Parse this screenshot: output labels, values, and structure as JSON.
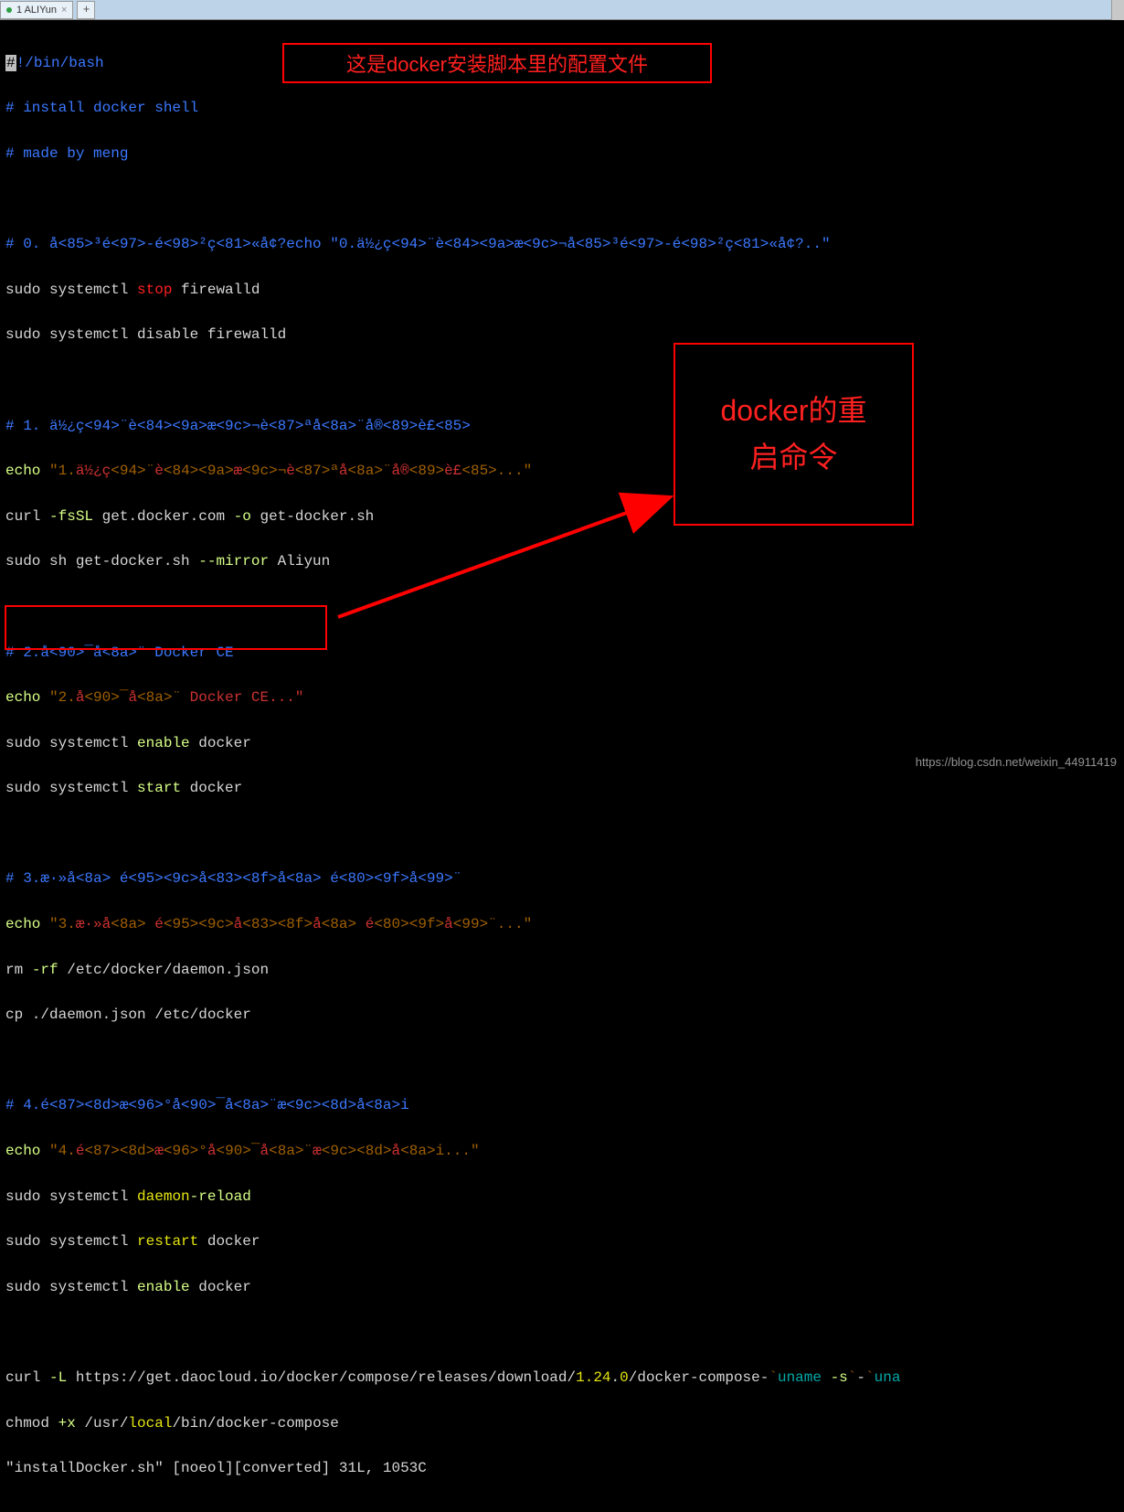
{
  "tab": {
    "title": "1 ALIYun",
    "close": "×",
    "add": "+"
  },
  "callouts": {
    "top": "这是docker安装脚本里的配置文件",
    "right": "docker的重\n启命令"
  },
  "watermark": "https://blog.csdn.net/weixin_44911419",
  "lines": {
    "shebang_hash": "#",
    "shebang_rest": "!/bin/bash",
    "c_install": "# install docker shell",
    "c_made": "# made by meng",
    "c_step0": "# 0. å<85>³é<97>-é<98>²ç<81>«å¢?echo \"0.ä½¿ç<94>¨è<84><9a>æ<9c>¬å<85>³é<97>-é<98>²ç<81>«å¢?..\"",
    "l5a": "sudo systemctl ",
    "l5b": "stop",
    "l5c": " firewalld",
    "l6a": "sudo systemctl disable firewalld",
    "c_step1": "# 1. ä½¿ç<94>¨è<84><9a>æ<9c>¬è<87>ªå<8a>¨å®<89>è£<85>",
    "l8a": "echo ",
    "l8b": "\"1.",
    "l8c": "ä½¿ç",
    "l8s1": "<94>¨",
    "l8d": "è",
    "l8s2": "<84><9a>",
    "l8e": "æ",
    "l8s3": "<9c>¬",
    "l8f": "è",
    "l8s4": "<87>ª",
    "l8g": "å",
    "l8s5": "<8a>¨",
    "l8h": "å®",
    "l8s6": "<89>",
    "l8i": "è£",
    "l8s7": "<85>",
    "l8end": "...\"",
    "l9a": "curl ",
    "l9b": "-fsSL",
    "l9c": " get.docker.com ",
    "l9d": "-o",
    "l9e": " get-docker.sh",
    "l10a": "sudo sh get-docker.sh ",
    "l10b": "--mirror",
    "l10c": " Aliyun",
    "c_step2": "# 2.å<90>¯å<8a>¨ Docker CE",
    "l12a": "echo ",
    "l12b": "\"2.",
    "l12c": "å",
    "l12s1": "<90>¯",
    "l12d": "å",
    "l12s2": "<8a>¨",
    "l12e": " Docker CE...\"",
    "l13a": "sudo systemctl ",
    "l13b": "enable",
    "l13c": " docker",
    "l14a": "sudo systemctl ",
    "l14b": "start",
    "l14c": " docker",
    "c_step3": "# 3.æ·»å<8a> é<95><9c>å<83><8f>å<8a> é<80><9f>å<99>¨",
    "l16a": "echo ",
    "l16b": "\"3.",
    "l16c": "æ·»å",
    "l16s1": "<8a> ",
    "l16d": "é",
    "l16s2": "<95><9c>",
    "l16e": "å",
    "l16s3": "<83><8f>",
    "l16f": "å",
    "l16s4": "<8a> ",
    "l16g": "é",
    "l16s5": "<80><9f>",
    "l16h": "å",
    "l16s6": "<99>¨",
    "l16end": "...\"",
    "l17a": "rm ",
    "l17b": "-rf",
    "l17c": " /etc/docker/daemon.json",
    "l18a": "cp ./daemon.json /etc/docker",
    "c_step4": "# 4.é<87><8d>æ<96>°å<90>¯å<8a>¨æ<9c><8d>å<8a>i",
    "l20a": "echo ",
    "l20b": "\"4.",
    "l20c": "é",
    "l20s1": "<87><8d>",
    "l20d": "æ",
    "l20s2": "<96>°",
    "l20e": "å",
    "l20s3": "<90>¯",
    "l20f": "å",
    "l20s4": "<8a>¨",
    "l20g": "æ",
    "l20s5": "<9c><8d>",
    "l20h": "å",
    "l20s6": "<8a>",
    "l20i": "i",
    "l20end": "...\"",
    "l21a": "sudo systemctl ",
    "l21b": "daemon",
    "l21c": "-reload",
    "l22a": "sudo systemctl ",
    "l22b": "restart",
    "l22c": " docker",
    "l23a": "sudo systemctl ",
    "l23b": "enable",
    "l23c": " docker",
    "l24a": "curl ",
    "l24b": "-L",
    "l24c": " https://get.daocloud.io/docker/compose/releases/download/",
    "l24d": "1.24",
    "l24e": ".",
    "l24f": "0",
    "l24g": "/docker-compose-",
    "l24h": "`",
    "l24i": "uname ",
    "l24j": "-s",
    "l24k": "`",
    "l24l": "-",
    "l24m": "`",
    "l24n": "una",
    "l25a": "chmod ",
    "l25b": "+x",
    "l25c": " /usr/",
    "l25d": "local",
    "l25e": "/bin/docker-compose",
    "l26a": "\"installDocker.sh\" [noeol][converted] 31L, 1053C"
  }
}
